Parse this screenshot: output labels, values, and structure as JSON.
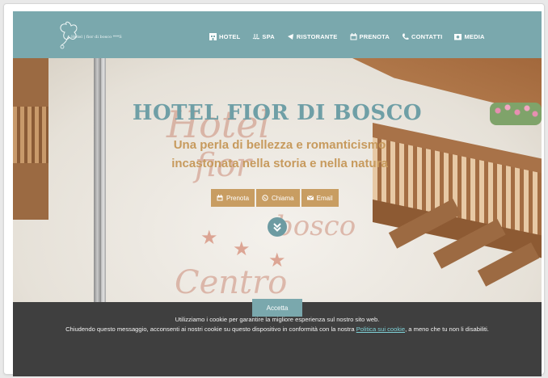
{
  "logo": {
    "text": "Hotel | fior di bosco ***S"
  },
  "nav": [
    {
      "label": "HOTEL",
      "icon": "hotel-icon"
    },
    {
      "label": "SPA",
      "icon": "spa-icon"
    },
    {
      "label": "RISTORANTE",
      "icon": "restaurant-icon"
    },
    {
      "label": "PRENOTA",
      "icon": "calendar-icon"
    },
    {
      "label": "CONTATTI",
      "icon": "phone-icon"
    },
    {
      "label": "MEDIA",
      "icon": "camera-icon"
    }
  ],
  "hero": {
    "title": "HOTEL FIOR DI BOSCO",
    "subtitle_line1": "Una perla di bellezza e romanticismo",
    "subtitle_line2": "incastonata nella storia e nella natura",
    "buttons": [
      {
        "label": "Prenota",
        "icon": "calendar-icon"
      },
      {
        "label": "Chiama",
        "icon": "whatsapp-icon"
      },
      {
        "label": "Email",
        "icon": "envelope-icon"
      }
    ]
  },
  "cookie": {
    "line1": "Utilizziamo i cookie per garantire la migliore esperienza sul nostro sito web.",
    "line2_before": "Chiudendo questo messaggio, acconsenti ai nostri cookie su questo dispositivo in conformità con la nostra ",
    "link": "Politica sui cookie",
    "line2_after": ", a meno che tu non li disabiliti.",
    "accept": "Accetta"
  },
  "colors": {
    "header": "#7aa8ad",
    "title": "#6f9fa6",
    "subtitle": "#c79a5d",
    "button": "#c89d62",
    "cookie_bg": "#3f3f3f",
    "link": "#7fd2d8"
  }
}
